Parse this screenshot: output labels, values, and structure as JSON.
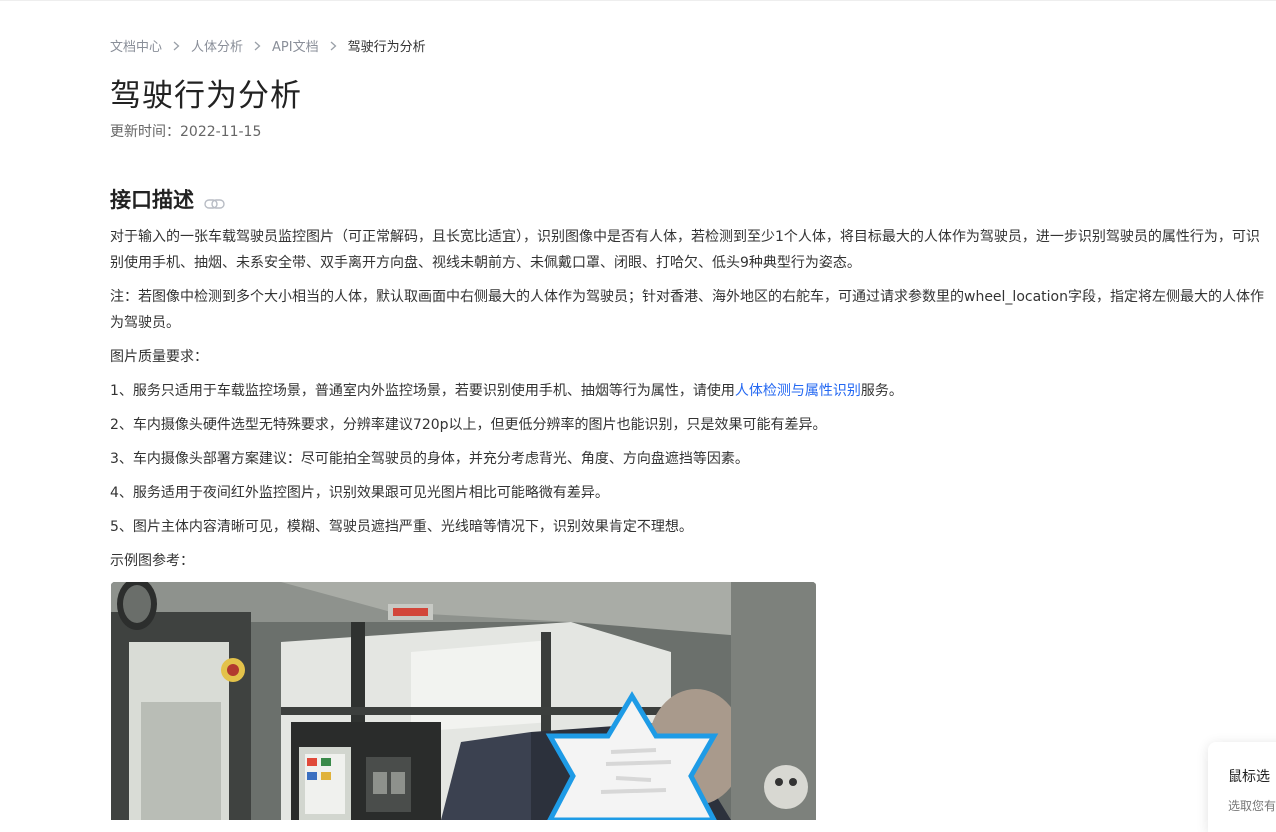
{
  "breadcrumb": {
    "items": [
      "文档中心",
      "人体分析",
      "API文档",
      "驾驶行为分析"
    ]
  },
  "page": {
    "title": "驾驶行为分析",
    "updated_label": "更新时间：",
    "updated_date": "2022-11-15"
  },
  "section": {
    "title": "接口描述",
    "link_icon": "link-icon"
  },
  "content": {
    "description": "对于输入的一张车载驾驶员监控图片（可正常解码，且长宽比适宜），识别图像中是否有人体，若检测到至少1个人体，将目标最大的人体作为驾驶员，进一步识别驾驶员的属性行为，可识别使用手机、抽烟、未系安全带、双手离开方向盘、视线未朝前方、未佩戴口罩、闭眼、打哈欠、低头9种典型行为姿态。",
    "note": "注：若图像中检测到多个大小相当的人体，默认取画面中右侧最大的人体作为驾驶员；针对香港、海外地区的右舵车，可通过请求参数里的wheel_location字段，指定将左侧最大的人体作为驾驶员。",
    "quality_heading": "图片质量要求：",
    "req1_before": "1、服务只适用于车载监控场景，普通室内外监控场景，若要识别使用手机、抽烟等行为属性，请使用",
    "req1_link": "人体检测与属性识别",
    "req1_after": "服务。",
    "req2": "2、车内摄像头硬件选型无特殊要求，分辨率建议720p以上，但更低分辨率的图片也能识别，只是效果可能有差异。",
    "req3": "3、车内摄像头部署方案建议：尽可能拍全驾驶员的身体，并充分考虑背光、角度、方向盘遮挡等因素。",
    "req4": "4、服务适用于夜间红外监控图片，识别效果跟可见光图片相比可能略微有差异。",
    "req5": "5、图片主体内容清晰可见，模糊、驾驶员遮挡严重、光线暗等情况下，识别效果肯定不理想。",
    "example_heading": "示例图参考："
  },
  "popup": {
    "title": "鼠标选",
    "subtitle": "选取您有"
  },
  "colors": {
    "link": "#2468f2",
    "title": "#222222",
    "text": "#333333",
    "muted": "#8a8f99",
    "star_outline": "#1e9be6"
  }
}
